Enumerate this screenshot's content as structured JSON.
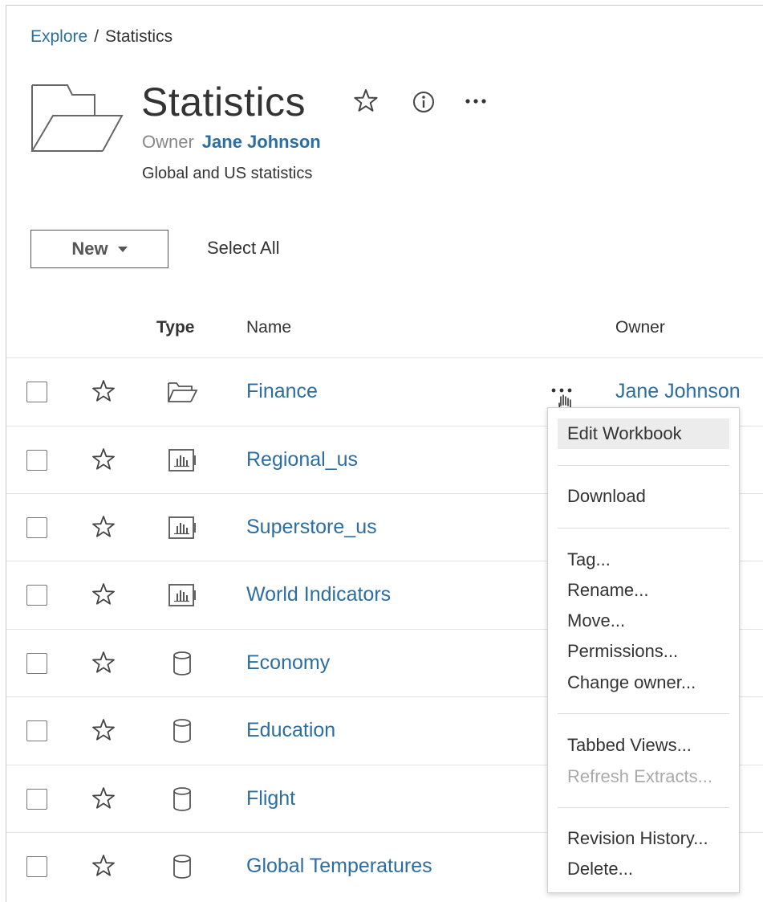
{
  "breadcrumb": {
    "root": "Explore",
    "separator": "/",
    "current": "Statistics"
  },
  "header": {
    "title": "Statistics",
    "owner_label": "Owner",
    "owner_name": "Jane Johnson",
    "description": "Global and US statistics",
    "icons": [
      "star-outline-icon",
      "info-icon",
      "more-horizontal-icon"
    ]
  },
  "toolbar": {
    "new_label": "New",
    "select_all_label": "Select All"
  },
  "table": {
    "columns": {
      "type": "Type",
      "name": "Name",
      "owner": "Owner"
    },
    "rows": [
      {
        "name": "Finance",
        "type_icon": "folder-icon"
      },
      {
        "name": "Regional_us",
        "type_icon": "workbook-icon"
      },
      {
        "name": "Superstore_us",
        "type_icon": "workbook-icon"
      },
      {
        "name": "World Indicators",
        "type_icon": "workbook-icon"
      },
      {
        "name": "Economy",
        "type_icon": "datasource-icon"
      },
      {
        "name": "Education",
        "type_icon": "datasource-icon"
      },
      {
        "name": "Flight",
        "type_icon": "datasource-icon"
      },
      {
        "name": "Global Temperatures",
        "type_icon": "datasource-icon"
      }
    ],
    "first_row_owner": "Jane Johnson"
  },
  "context_menu": {
    "items": [
      {
        "label": "Edit Workbook",
        "highlighted": true,
        "disabled": false
      },
      {
        "label": "Download",
        "disabled": false
      },
      {
        "label": "Tag...",
        "disabled": false
      },
      {
        "label": "Rename...",
        "disabled": false
      },
      {
        "label": "Move...",
        "disabled": false
      },
      {
        "label": "Permissions...",
        "disabled": false
      },
      {
        "label": "Change owner...",
        "disabled": false
      },
      {
        "label": "Tabbed Views...",
        "disabled": false
      },
      {
        "label": "Refresh Extracts...",
        "disabled": true
      },
      {
        "label": "Revision History...",
        "disabled": false
      },
      {
        "label": "Delete...",
        "disabled": false
      }
    ]
  },
  "colors": {
    "link": "#2b6ea3",
    "text": "#333333",
    "muted": "#888888",
    "disabled": "#aaaaaa",
    "highlight": "#ececec"
  }
}
